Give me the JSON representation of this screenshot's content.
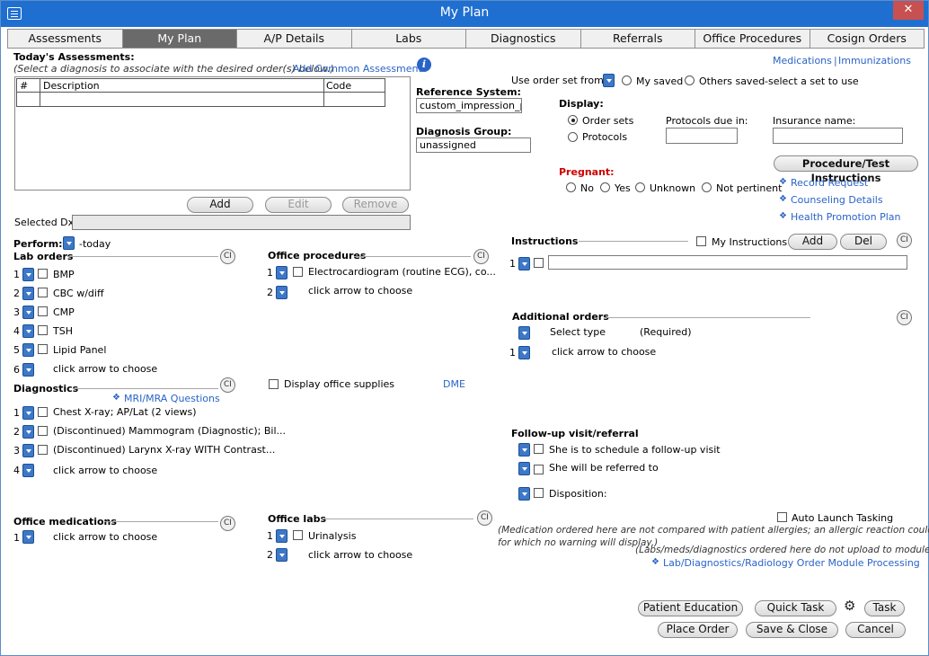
{
  "window": {
    "title": "My Plan",
    "close": "✕"
  },
  "tabs": [
    "Assessments",
    "My Plan",
    "A/P Details",
    "Labs",
    "Diagnostics",
    "Referrals",
    "Office Procedures",
    "Cosign Orders"
  ],
  "assessments": {
    "title": "Today's Assessments:",
    "hint": "(Select a diagnosis to associate with the desired order(s) below.)",
    "add_common": "Add Common Assessment",
    "columns": [
      "#",
      "Description",
      "Code"
    ],
    "add": "Add",
    "edit": "Edit",
    "remove": "Remove",
    "selected_dx_label": "Selected Dx:"
  },
  "reference": {
    "label": "Reference System:",
    "value": "custom_impression_pl"
  },
  "diagnosis_group": {
    "label": "Diagnosis Group:",
    "value": "unassigned"
  },
  "top_links": {
    "medications": "Medications",
    "separator": "|",
    "immunizations": "Immunizations"
  },
  "order_set": {
    "label": "Use order set from:",
    "my_saved": "My saved",
    "others_saved": "Others saved",
    "hint": "-select a set to use"
  },
  "display": {
    "label": "Display:",
    "order_sets": "Order sets",
    "protocols": "Protocols",
    "protocols_due": "Protocols due in:",
    "insurance": "Insurance name:"
  },
  "pregnant": {
    "label": "Pregnant:",
    "no": "No",
    "yes": "Yes",
    "unknown": "Unknown",
    "not_pertinent": "Not pertinent"
  },
  "procedure_btn": "Procedure/Test Instructions",
  "side_links": [
    "Record Request",
    "Counseling Details",
    "Health Promotion Plan"
  ],
  "perform": {
    "label": "Perform:",
    "value": "-today"
  },
  "lab_orders": {
    "title": "Lab orders",
    "items": [
      "BMP",
      "CBC w/diff",
      "CMP",
      "TSH",
      "Lipid Panel"
    ],
    "choose": "click arrow to choose",
    "nums": [
      "1",
      "2",
      "3",
      "4",
      "5",
      "6"
    ]
  },
  "office_procedures": {
    "title": "Office procedures",
    "items": [
      "Electrocardiogram (routine ECG), co..."
    ],
    "choose": "click arrow to choose",
    "nums": [
      "1",
      "2"
    ]
  },
  "display_supplies": "Display office supplies",
  "dme": "DME",
  "diagnostics": {
    "title": "Diagnostics",
    "mri_link": "MRI/MRA Questions",
    "items": [
      "Chest X-ray; AP/Lat (2 views)",
      "(Discontinued) Mammogram (Diagnostic); Bil...",
      "(Discontinued) Larynx X-ray WITH Contrast..."
    ],
    "choose": "click arrow to choose",
    "nums": [
      "1",
      "2",
      "3",
      "4"
    ]
  },
  "office_medications": {
    "title": "Office medications",
    "choose": "click arrow to choose",
    "num": "1"
  },
  "office_labs": {
    "title": "Office labs",
    "items": [
      "Urinalysis"
    ],
    "choose": "click arrow to choose",
    "nums": [
      "1",
      "2"
    ]
  },
  "instructions": {
    "title": "Instructions",
    "my_instructions": "My Instructions",
    "add": "Add",
    "del": "Del",
    "num": "1"
  },
  "additional_orders": {
    "title": "Additional orders",
    "select_type": "Select type",
    "required": "(Required)",
    "choose": "click arrow to choose",
    "num": "1"
  },
  "followup": {
    "title": "Follow-up visit/referral",
    "items": [
      "She is to schedule a follow-up visit",
      "She will be referred to",
      "Disposition:"
    ]
  },
  "auto_launch": "Auto Launch Tasking",
  "notes": {
    "allergy_line1": "(Medication ordered here are not compared with patient allergies; an allergic reaction could occur",
    "allergy_line2": "for which no warning will display.)",
    "upload": "(Labs/meds/diagnostics ordered here do not upload to modules.)",
    "processing_link": "Lab/Diagnostics/Radiology Order Module Processing"
  },
  "ci_label": "CI",
  "bottom_buttons": {
    "patient_education": "Patient Education",
    "quick_task": "Quick Task",
    "task": "Task",
    "place_order": "Place Order",
    "save_close": "Save & Close",
    "cancel": "Cancel"
  },
  "colors": {
    "titlebar": "#1f6fd1",
    "active_tab": "#6a6a6a",
    "link": "#2a63c7",
    "pregnant": "#cc0000",
    "dropdown": "#3d78c8"
  }
}
